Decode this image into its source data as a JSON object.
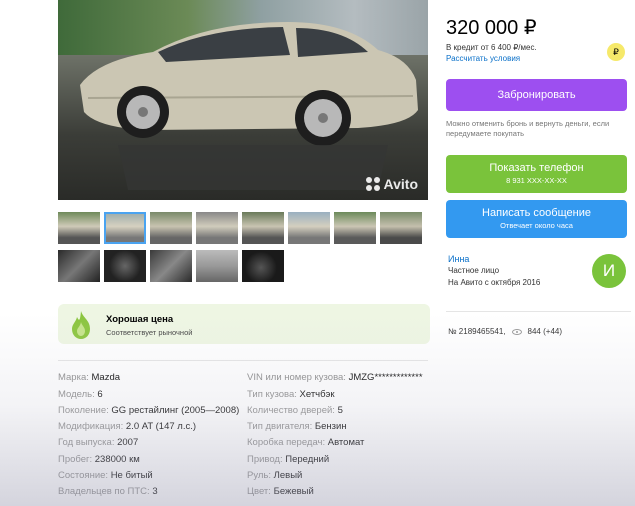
{
  "listing": {
    "price": "320 000 ₽",
    "credit_text": "В кредит от 6 400 ₽/мес.",
    "credit_link": "Рассчитать условия",
    "credit_badge_icon": "coin-icon"
  },
  "gallery": {
    "watermark": "Avito",
    "thumbnail_count": 13,
    "selected_thumbnail": 2
  },
  "actions": {
    "book_label": "Забронировать",
    "book_note": "Можно отменить бронь и вернуть деньги, если передумаете покупать",
    "phone_label": "Показать телефон",
    "phone_sub": "8 931 XXX-XX-XX",
    "message_label": "Написать сообщение",
    "message_sub": "Отвечает около часа"
  },
  "seller": {
    "name": "Инна",
    "type": "Частное лицо",
    "since": "На Авито с октября 2016",
    "avatar_letter": "И",
    "avatar_color": "#7ac33b"
  },
  "ad": {
    "number": "№ 2189465541,",
    "views": "844 (+44)"
  },
  "price_badge": {
    "title": "Хорошая цена",
    "subtitle": "Соответствует рыночной"
  },
  "specs_left": [
    {
      "key": "Марка:",
      "value": "Mazda"
    },
    {
      "key": "Модель:",
      "value": "6"
    },
    {
      "key": "Поколение:",
      "value": "GG рестайлинг (2005—2008)"
    },
    {
      "key": "Модификация:",
      "value": "2.0 AT (147 л.с.)"
    },
    {
      "key": "Год выпуска:",
      "value": "2007"
    },
    {
      "key": "Пробег:",
      "value": "238000 км"
    },
    {
      "key": "Состояние:",
      "value": "Не битый"
    },
    {
      "key": "Владельцев по ПТС:",
      "value": "3"
    }
  ],
  "specs_right": [
    {
      "key": "VIN или номер кузова:",
      "value": "JMZG*************"
    },
    {
      "key": "Тип кузова:",
      "value": "Хетчбэк"
    },
    {
      "key": "Количество дверей:",
      "value": "5"
    },
    {
      "key": "Тип двигателя:",
      "value": "Бензин"
    },
    {
      "key": "Коробка передач:",
      "value": "Автомат"
    },
    {
      "key": "Привод:",
      "value": "Передний"
    },
    {
      "key": "Руль:",
      "value": "Левый"
    },
    {
      "key": "Цвет:",
      "value": "Бежевый"
    }
  ],
  "colors": {
    "book_button": "#9d4ff0",
    "phone_button": "#7ac33b",
    "message_button": "#3399f0",
    "link": "#0a70c9"
  }
}
